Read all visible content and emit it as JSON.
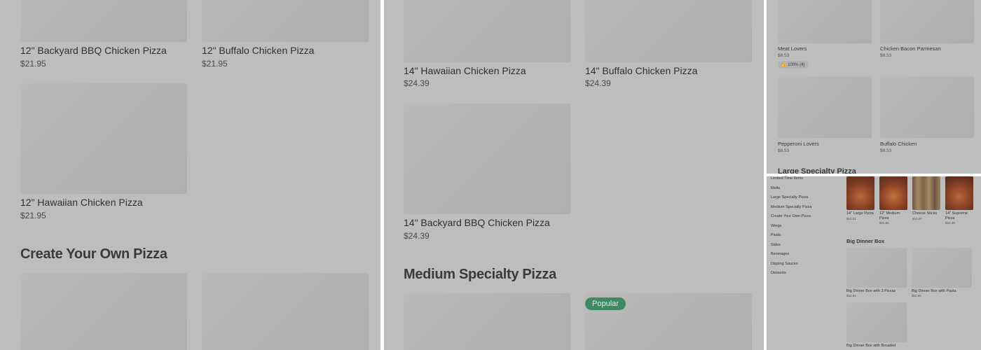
{
  "panel1": {
    "items_top": [
      {
        "name": "12\" Backyard BBQ Chicken Pizza",
        "price": "$21.95"
      },
      {
        "name": "12\" Buffalo Chicken Pizza",
        "price": "$21.95"
      }
    ],
    "item_mid": {
      "name": "12\" Hawaiian Chicken Pizza",
      "price": "$21.95"
    },
    "section_heading": "Create Your Own Pizza"
  },
  "panel2": {
    "items_top": [
      {
        "name": "14\" Hawaiian Chicken Pizza",
        "price": "$24.39"
      },
      {
        "name": "14\" Buffalo Chicken Pizza",
        "price": "$24.39"
      }
    ],
    "item_mid": {
      "name": "14\" Backyard BBQ Chicken Pizza",
      "price": "$24.39"
    },
    "section_heading": "Medium Specialty Pizza",
    "badge": "Popular"
  },
  "panel3": {
    "items": [
      {
        "name": "Meat Lovers",
        "price": "$8.53"
      },
      {
        "name": "Chicken Bacon Parmesan",
        "price": "$8.53"
      },
      {
        "name": "Pepperoni Lovers",
        "price": "$8.53"
      },
      {
        "name": "Buffalo Chicken",
        "price": "$8.53"
      }
    ],
    "rating": "100% (4)",
    "section_heading": "Large Specialty Pizza"
  },
  "panel4": {
    "nav": [
      "Limited Time Items",
      "Melts",
      "Large Specialty Pizza",
      "Medium Specialty Pizza",
      "Create Your Own Pizza",
      "Wings",
      "Pasta",
      "Sides",
      "Beverages",
      "Dipping Sauces",
      "Desserts"
    ],
    "top_items": [
      {
        "name": "14\" Large Pizza",
        "price": "$19.51"
      },
      {
        "name": "12\" Medium Pizza",
        "price": "$15.85"
      },
      {
        "name": "Cheese Sticks",
        "price": "$10.97"
      },
      {
        "name": "14\" Supreme Pizza",
        "price": "$24.39"
      }
    ],
    "section_heading": "Big Dinner Box",
    "box_items": [
      {
        "name": "Big Dinner Box with 3 Pizzas",
        "price": "$32.94"
      },
      {
        "name": "Big Dinner Box with Pasta",
        "price": "$32.95"
      },
      {
        "name": "Big Dinner Box with Breaded",
        "price": ""
      }
    ]
  }
}
